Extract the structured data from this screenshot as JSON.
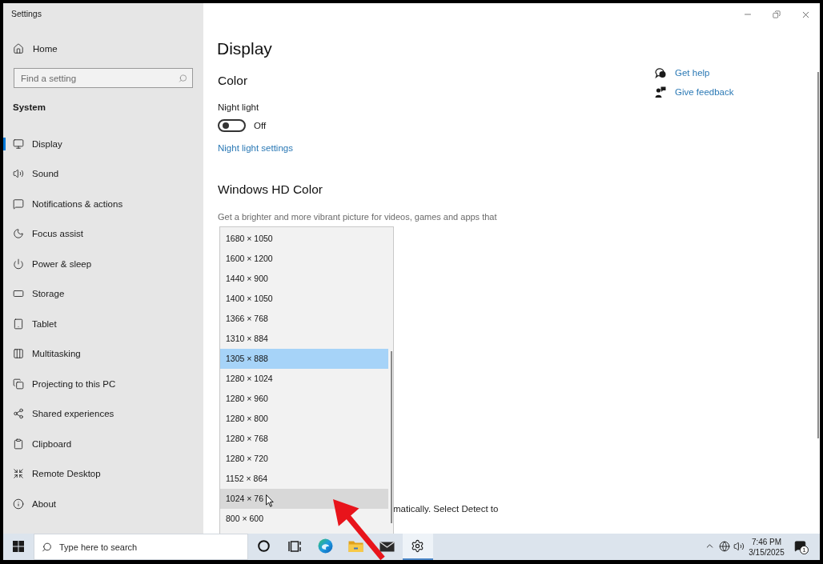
{
  "window": {
    "title": "Settings"
  },
  "sidebar": {
    "home": "Home",
    "search": {
      "placeholder": "Find a setting"
    },
    "section": "System",
    "items": [
      {
        "label": "Display",
        "selected": true
      },
      {
        "label": "Sound",
        "selected": false
      },
      {
        "label": "Notifications & actions",
        "selected": false
      },
      {
        "label": "Focus assist",
        "selected": false
      },
      {
        "label": "Power & sleep",
        "selected": false
      },
      {
        "label": "Storage",
        "selected": false
      },
      {
        "label": "Tablet",
        "selected": false
      },
      {
        "label": "Multitasking",
        "selected": false
      },
      {
        "label": "Projecting to this PC",
        "selected": false
      },
      {
        "label": "Shared experiences",
        "selected": false
      },
      {
        "label": "Clipboard",
        "selected": false
      },
      {
        "label": "Remote Desktop",
        "selected": false
      },
      {
        "label": "About",
        "selected": false
      }
    ]
  },
  "main": {
    "title": "Display",
    "color_heading": "Color",
    "night_light": {
      "label": "Night light",
      "on": false,
      "state": "Off"
    },
    "night_light_link": "Night light settings",
    "hd_heading": "Windows HD Color",
    "hd_description": "Get a brighter and more vibrant picture for videos, games and apps that",
    "detect_text": "matically. Select Detect to"
  },
  "related": {
    "links": [
      "Get help",
      "Give feedback"
    ]
  },
  "resolution_dropdown": {
    "options": [
      {
        "label": "1680 × 1050",
        "selected": false,
        "hovered": false
      },
      {
        "label": "1600 × 1200",
        "selected": false,
        "hovered": false
      },
      {
        "label": "1440 × 900",
        "selected": false,
        "hovered": false
      },
      {
        "label": "1400 × 1050",
        "selected": false,
        "hovered": false
      },
      {
        "label": "1366 × 768",
        "selected": false,
        "hovered": false
      },
      {
        "label": "1310 × 884",
        "selected": false,
        "hovered": false
      },
      {
        "label": "1305 × 888",
        "selected": true,
        "hovered": false
      },
      {
        "label": "1280 × 1024",
        "selected": false,
        "hovered": false
      },
      {
        "label": "1280 × 960",
        "selected": false,
        "hovered": false
      },
      {
        "label": "1280 × 800",
        "selected": false,
        "hovered": false
      },
      {
        "label": "1280 × 768",
        "selected": false,
        "hovered": false
      },
      {
        "label": "1280 × 720",
        "selected": false,
        "hovered": false
      },
      {
        "label": "1152 × 864",
        "selected": false,
        "hovered": false
      },
      {
        "label": "1024 × 76",
        "selected": false,
        "hovered": true
      },
      {
        "label": "800 × 600",
        "selected": false,
        "hovered": false
      }
    ]
  },
  "taskbar": {
    "search": {
      "placeholder": "Type here to search"
    },
    "apps": [
      {
        "selected": false
      },
      {
        "selected": false
      },
      {
        "selected": false
      },
      {
        "selected": false
      },
      {
        "selected": false
      },
      {
        "selected": true
      }
    ],
    "time": "7:46 PM",
    "date": "3/15/2025",
    "notification_count": "1"
  }
}
